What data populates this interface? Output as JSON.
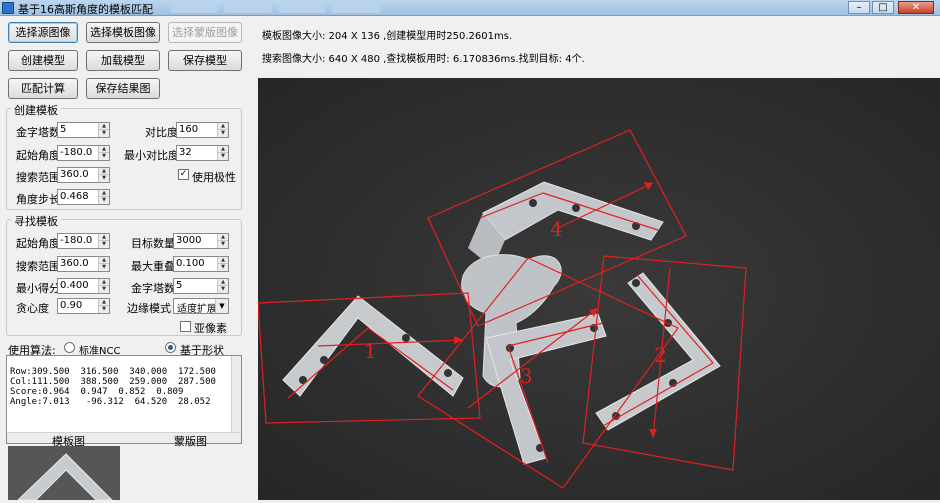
{
  "window": {
    "title": "基于16高斯角度的模板匹配",
    "tabs": [
      "",
      "",
      "",
      ""
    ]
  },
  "buttons": {
    "select_source": "选择源图像",
    "select_template": "选择模板图像",
    "select_mask": "选择蒙版图像",
    "create_model": "创建模型",
    "load_model": "加载模型",
    "save_model": "保存模型",
    "match_compute": "匹配计算",
    "save_result": "保存结果图"
  },
  "create_group": {
    "title": "创建模板",
    "pyramid_label": "金字塔数",
    "pyramid_value": "5",
    "contrast_label": "对比度",
    "contrast_value": "160",
    "start_angle_label": "起始角度",
    "start_angle_value": "-180.0",
    "min_contrast_label": "最小对比度",
    "min_contrast_value": "32",
    "search_range_label": "搜索范围",
    "search_range_value": "360.0",
    "polarity_label": "使用极性",
    "polarity_checked": true,
    "angle_step_label": "角度步长",
    "angle_step_value": "0.468"
  },
  "find_group": {
    "title": "寻找模板",
    "start_angle_label": "起始角度",
    "start_angle_value": "-180.0",
    "target_count_label": "目标数量",
    "target_count_value": "3000",
    "search_range_label": "搜索范围",
    "search_range_value": "360.0",
    "max_overlap_label": "最大重叠",
    "max_overlap_value": "0.100",
    "min_score_label": "最小得分",
    "min_score_value": "0.400",
    "pyramid_label": "金字塔数",
    "pyramid_value": "5",
    "greediness_label": "贪心度",
    "greediness_value": "0.90",
    "edge_mode_label": "边缘模式",
    "edge_mode_value": "适度扩展",
    "subpixel_label": "亚像素",
    "subpixel_checked": false
  },
  "algorithm": {
    "label": "使用算法:",
    "option_ncc": "标准NCC",
    "option_shape": "基于形状",
    "selected": "基于形状"
  },
  "results": {
    "row": "Row:309.500  316.500  340.000  172.500",
    "col": "Col:111.500  388.500  259.000  287.500",
    "score": "Score:0.964  0.947  0.852  0.809",
    "angle": "Angle:7.013   -96.312  64.520  28.052"
  },
  "bottom_labels": {
    "template": "模板图",
    "mask": "蒙版图"
  },
  "info": {
    "line1": "模板图像大小: 204 X 136 ,创建模型用时250.2601ms.",
    "line2": "搜索图像大小: 640 X 480 ,查找模板用时: 6.170836ms.找到目标: 4个."
  },
  "matches": [
    {
      "label": "1"
    },
    {
      "label": "2"
    },
    {
      "label": "3"
    },
    {
      "label": "4"
    }
  ],
  "colors": {
    "match": "#e02020",
    "viewer_bg": "#2e2e2e",
    "titlebar": "#a9c8e8"
  }
}
